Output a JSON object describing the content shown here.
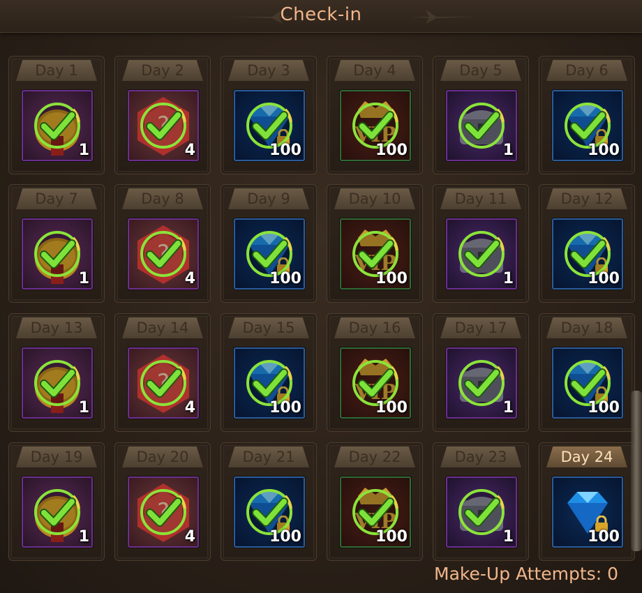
{
  "title": "Check-in",
  "make_up": {
    "label": "Make-Up Attempts:",
    "count": "0"
  },
  "reward_types": {
    "pouch": {
      "icon": "gold-pouch-icon",
      "border": "#6b2f8f",
      "bg1": "#5a2a58",
      "bg2": "#2a1528"
    },
    "card": {
      "icon": "mystery-level-card-icon",
      "border": "#6b2f8f",
      "bg1": "#6a3a3a",
      "bg2": "#3a1a20"
    },
    "diamond": {
      "icon": "blue-diamond-icon",
      "border": "#2b5c9a",
      "bg1": "#0c2a55",
      "bg2": "#061530"
    },
    "vip": {
      "icon": "vip-badge-icon",
      "border": "#2f6a35",
      "bg1": "#4a1e16",
      "bg2": "#28100c"
    },
    "chest": {
      "icon": "purple-chest-icon",
      "border": "#6b2f8f",
      "bg1": "#4a2a6a",
      "bg2": "#20122e"
    }
  },
  "days": [
    {
      "label": "Day 1",
      "type": "pouch",
      "count": "1",
      "claimed": true
    },
    {
      "label": "Day 2",
      "type": "card",
      "count": "4",
      "claimed": true
    },
    {
      "label": "Day 3",
      "type": "diamond",
      "count": "100",
      "claimed": true
    },
    {
      "label": "Day 4",
      "type": "vip",
      "count": "100",
      "claimed": true
    },
    {
      "label": "Day 5",
      "type": "chest",
      "count": "1",
      "claimed": true
    },
    {
      "label": "Day 6",
      "type": "diamond",
      "count": "100",
      "claimed": true
    },
    {
      "label": "Day 7",
      "type": "pouch",
      "count": "1",
      "claimed": true
    },
    {
      "label": "Day 8",
      "type": "card",
      "count": "4",
      "claimed": true
    },
    {
      "label": "Day 9",
      "type": "diamond",
      "count": "100",
      "claimed": true
    },
    {
      "label": "Day 10",
      "type": "vip",
      "count": "100",
      "claimed": true
    },
    {
      "label": "Day 11",
      "type": "chest",
      "count": "1",
      "claimed": true
    },
    {
      "label": "Day 12",
      "type": "diamond",
      "count": "100",
      "claimed": true
    },
    {
      "label": "Day 13",
      "type": "pouch",
      "count": "1",
      "claimed": true
    },
    {
      "label": "Day 14",
      "type": "card",
      "count": "4",
      "claimed": true
    },
    {
      "label": "Day 15",
      "type": "diamond",
      "count": "100",
      "claimed": true
    },
    {
      "label": "Day 16",
      "type": "vip",
      "count": "100",
      "claimed": true
    },
    {
      "label": "Day 17",
      "type": "chest",
      "count": "1",
      "claimed": true
    },
    {
      "label": "Day 18",
      "type": "diamond",
      "count": "100",
      "claimed": true
    },
    {
      "label": "Day 19",
      "type": "pouch",
      "count": "1",
      "claimed": true
    },
    {
      "label": "Day 20",
      "type": "card",
      "count": "4",
      "claimed": true
    },
    {
      "label": "Day 21",
      "type": "diamond",
      "count": "100",
      "claimed": true
    },
    {
      "label": "Day 22",
      "type": "vip",
      "count": "100",
      "claimed": true
    },
    {
      "label": "Day 23",
      "type": "chest",
      "count": "1",
      "claimed": true
    },
    {
      "label": "Day 24",
      "type": "diamond",
      "count": "100",
      "claimed": false,
      "current": true
    }
  ]
}
